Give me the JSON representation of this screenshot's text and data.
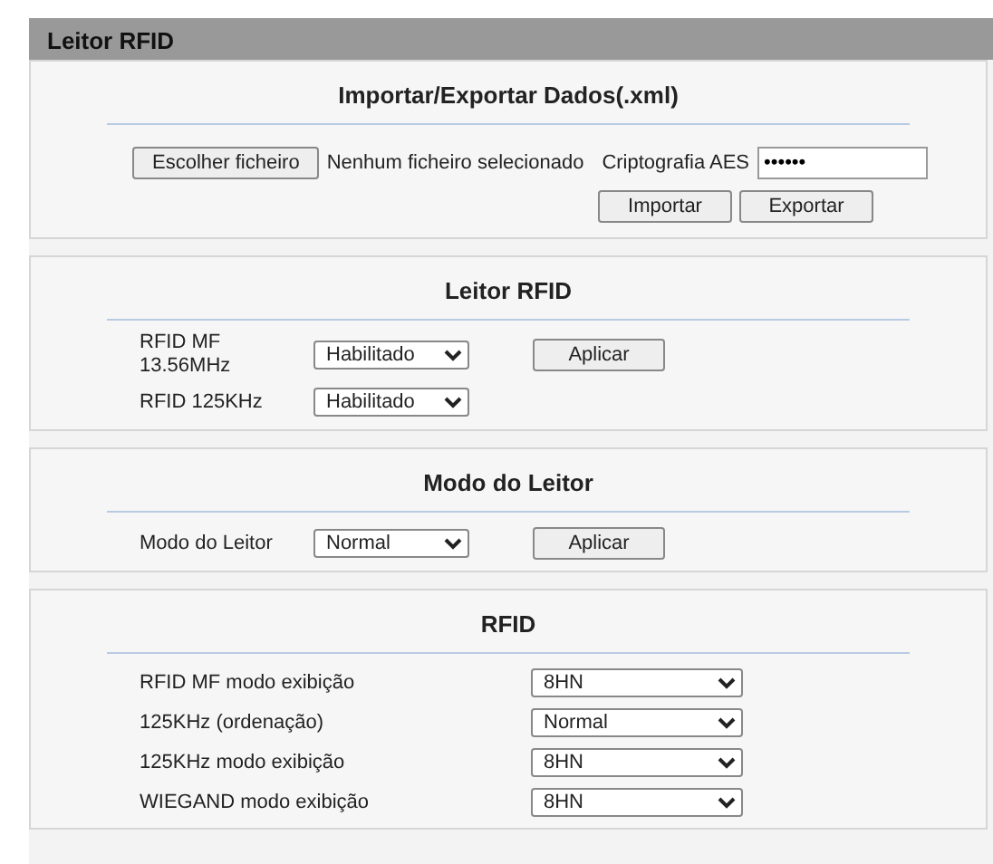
{
  "header": {
    "title": "Leitor RFID"
  },
  "import_export": {
    "title": "Importar/Exportar Dados(.xml)",
    "file_button": "Escolher ficheiro",
    "file_status": "Nenhum ficheiro selecionado",
    "aes_label": "Criptografia AES",
    "aes_value": "••••••",
    "buttons": [
      "Importar",
      "Exportar"
    ]
  },
  "reader": {
    "title": "Leitor RFID",
    "rows": [
      {
        "label": "RFID MF 13.56MHz",
        "value": "Habilitado",
        "button": "Aplicar"
      },
      {
        "label": "RFID 125KHz",
        "value": "Habilitado"
      }
    ]
  },
  "reader_mode": {
    "title": "Modo do Leitor",
    "rows": [
      {
        "label": "Modo do Leitor",
        "value": "Normal",
        "button": "Aplicar"
      }
    ]
  },
  "rfid": {
    "title": "RFID",
    "rows": [
      {
        "label": "RFID MF modo exibição",
        "value": "8HN"
      },
      {
        "label": "125KHz (ordenação)",
        "value": "Normal"
      },
      {
        "label": "125KHz modo exibição",
        "value": "8HN"
      },
      {
        "label": "WIEGAND modo exibição",
        "value": "8HN"
      }
    ]
  }
}
